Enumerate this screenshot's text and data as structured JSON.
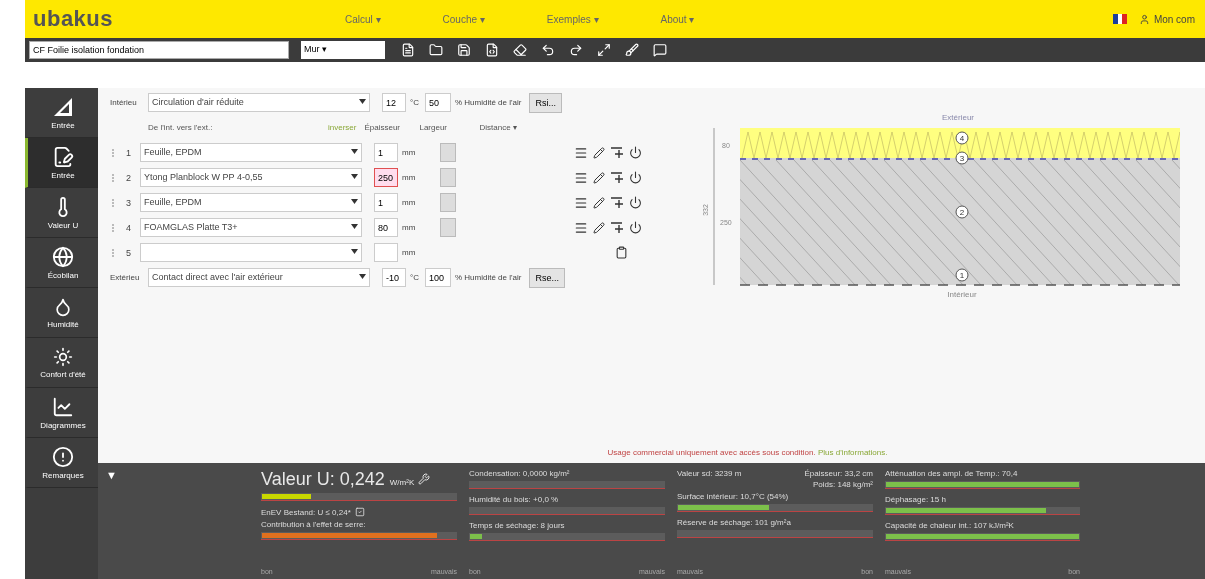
{
  "header": {
    "logo": "ubakus",
    "menu": [
      {
        "label": "Calcul ▾"
      },
      {
        "label": "Couche ▾"
      },
      {
        "label": "Exemples ▾"
      },
      {
        "label": "About ▾"
      }
    ],
    "account": "Mon com"
  },
  "toolbar": {
    "name": "CF Foilie isolation fondation",
    "type": "Mur ▾"
  },
  "sidebar": [
    {
      "label": "Entrée",
      "selected": false
    },
    {
      "label": "Entrée",
      "selected": true
    },
    {
      "label": "Valeur U",
      "selected": false
    },
    {
      "label": "Écobilan",
      "selected": false
    },
    {
      "label": "Humidité",
      "selected": false
    },
    {
      "label": "Confort d'été",
      "selected": false
    },
    {
      "label": "Diagrammes",
      "selected": false
    },
    {
      "label": "Remarques",
      "selected": false
    }
  ],
  "inside": {
    "label": "Intérieu",
    "air": "Circulation d'air réduite",
    "temp": "12",
    "temp_unit": "°C",
    "humidity": "50",
    "humidity_unit": "% Humidité de l'air",
    "button": "Rsi..."
  },
  "columns": {
    "direction": "De l'int. vers l'ext.:",
    "invert": "inverser",
    "thickness": "Épaisseur",
    "width": "Largeur",
    "distance": "Distance ▾"
  },
  "layers": [
    {
      "kind": "layer",
      "number": "1",
      "material": "Feuille, EPDM",
      "thickness": "1",
      "unit": "mm",
      "warning": false
    },
    {
      "kind": "layer",
      "number": "2",
      "material": "Ytong Planblock W PP 4-0,55",
      "thickness": "250",
      "unit": "mm",
      "warning": true
    },
    {
      "kind": "layer",
      "number": "3",
      "material": "Feuille, EPDM",
      "thickness": "1",
      "unit": "mm",
      "warning": false
    },
    {
      "kind": "layer",
      "number": "4",
      "material": "FOAMGLAS Platte T3+",
      "thickness": "80",
      "unit": "mm",
      "warning": false
    },
    {
      "kind": "empty",
      "number": "5",
      "unit": "mm",
      "warning": false
    }
  ],
  "outside": {
    "label": "Extérieu",
    "air": "Contact direct avec l'air extérieur",
    "temp": "-10",
    "temp_unit": "°C",
    "humidity": "100",
    "humidity_unit": "% Humidité de l'air",
    "button": "Rse..."
  },
  "diagram": {
    "top_label": "Extérieur",
    "bottom_label": "Intérieur",
    "total": "332",
    "dims": [
      "80",
      "250"
    ],
    "markers": [
      "4",
      "3",
      "2",
      "1"
    ]
  },
  "notice": {
    "text": "Usage commercial uniquement avec accès sous condition.",
    "link": "Plus d'informations."
  },
  "collapse": "▼",
  "results": [
    {
      "kind": "uvalue",
      "title": "Valeur U:",
      "value": "0,242",
      "unit": "W/m²K",
      "level": 0.25,
      "color": "#c8d800",
      "norm": "EnEV Bestand: U ≤ 0,24*",
      "meters": [
        {
          "label": "Contribution à l'effet de serre:",
          "level": 0.9,
          "color": "#e0701e"
        }
      ],
      "scale": [
        "bon",
        "mauvais"
      ]
    },
    {
      "kind": "meters",
      "meters": [
        {
          "label": "Condensation: 0,0000 kg/m²"
        },
        {
          "label": "Humidité du bois: +0,0 %"
        },
        {
          "label": "Temps de séchage: 8 jours",
          "level": 0.06,
          "color": "#7cc04a"
        }
      ],
      "scale": [
        "bon",
        "mauvais"
      ]
    },
    {
      "kind": "stats",
      "stats": [
        "Valeur sd: 3239 m",
        "Épaisseur: 33,2 cm",
        "Poids: 148 kg/m²"
      ],
      "meters": [
        {
          "label": "Surface intérieur: 10,7°C (54%)",
          "level": 0.47,
          "color": "#7cc04a"
        },
        {
          "label": "Réserve de séchage: 101 g/m²a"
        }
      ],
      "scale": [
        "mauvais",
        "bon"
      ]
    },
    {
      "kind": "meters",
      "meters": [
        {
          "label": "Atténuation des ampl. de Temp.: 70,4",
          "level": 1,
          "color": "#7cc04a"
        },
        {
          "label": "Déphasage: 15 h",
          "level": 0.83,
          "color": "#7cc04a"
        },
        {
          "label": "Capacité de chaleur int.: 107 kJ/m²K",
          "level": 1,
          "color": "#7cc04a"
        }
      ],
      "scale": [
        "mauvais",
        "bon"
      ]
    }
  ]
}
